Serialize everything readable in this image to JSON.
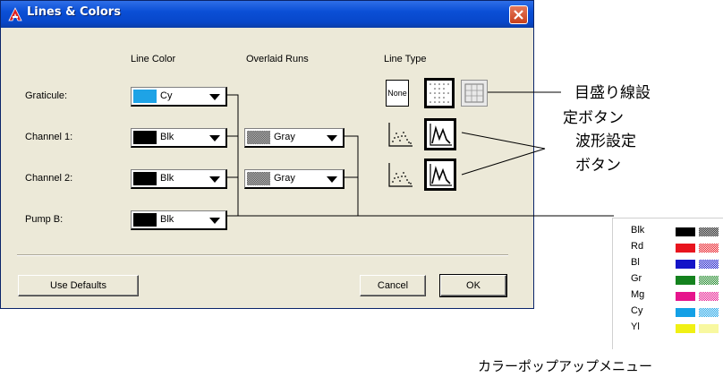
{
  "window": {
    "title": "Lines & Colors"
  },
  "headers": {
    "line_color": "Line Color",
    "overlaid_runs": "Overlaid Runs",
    "line_type": "Line Type"
  },
  "rows": [
    {
      "label": "Graticule:",
      "color": {
        "text": "Cy",
        "hex": "#1ea3e6"
      }
    },
    {
      "label": "Channel 1:",
      "color": {
        "text": "Blk",
        "hex": "#000000"
      },
      "overlay": {
        "text": "Gray"
      }
    },
    {
      "label": "Channel 2:",
      "color": {
        "text": "Blk",
        "hex": "#000000"
      },
      "overlay": {
        "text": "Gray"
      }
    },
    {
      "label": "Pump B:",
      "color": {
        "text": "Blk",
        "hex": "#000000"
      }
    }
  ],
  "line_type": {
    "none_label": "None"
  },
  "buttons": {
    "use_defaults": "Use Defaults",
    "cancel": "Cancel",
    "ok": "OK"
  },
  "annotations": {
    "graticule_btn": [
      "目盛り線設",
      "定ボタン"
    ],
    "waveform_btn": [
      "波形設定",
      "ボタン"
    ],
    "color_menu": "カラーポップアップメニュー"
  },
  "color_menu": [
    {
      "label": "Blk",
      "hex": "#000000",
      "light": "#909090"
    },
    {
      "label": "Rd",
      "hex": "#e8141e",
      "light": "#f08080"
    },
    {
      "label": "Bl",
      "hex": "#1414c8",
      "light": "#8080f0"
    },
    {
      "label": "Gr",
      "hex": "#14821e",
      "light": "#80c880"
    },
    {
      "label": "Mg",
      "hex": "#e6148c",
      "light": "#f080c8"
    },
    {
      "label": "Cy",
      "hex": "#14a0e6",
      "light": "#80d0f0"
    },
    {
      "label": "Yl",
      "hex": "#f0f014",
      "light": "#f8f8a0"
    }
  ]
}
